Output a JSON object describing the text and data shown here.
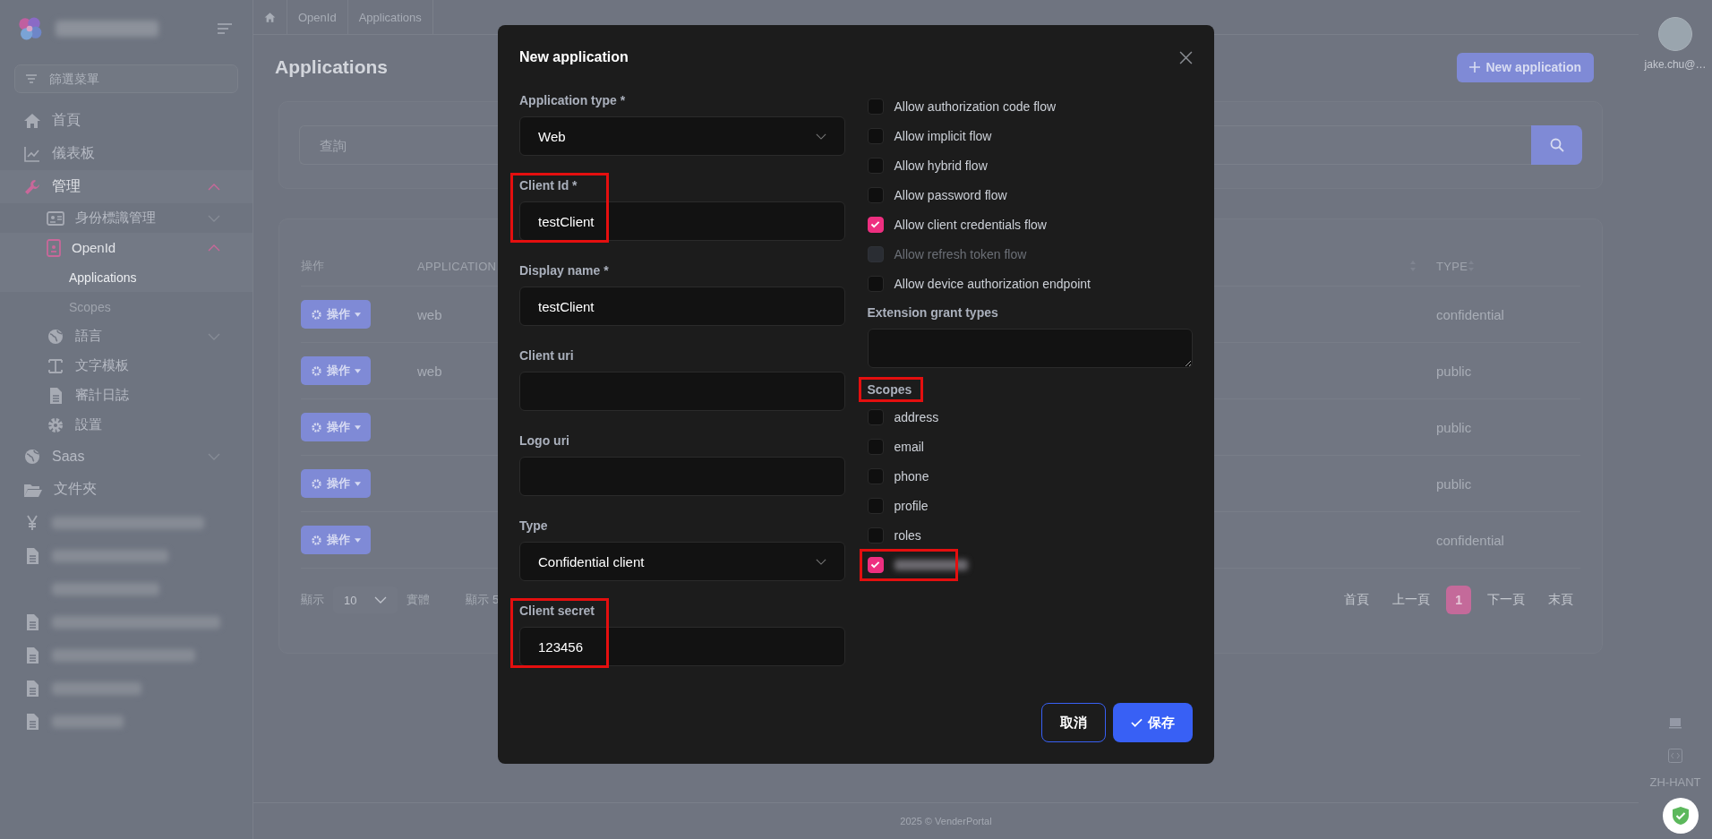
{
  "sidebar": {
    "filter": {
      "placeholder": "篩選菜單"
    },
    "items": [
      {
        "kind": "link",
        "label": "首頁"
      },
      {
        "kind": "link",
        "label": "儀表板"
      },
      {
        "kind": "group",
        "label": "管理",
        "expanded": true,
        "children": [
          {
            "kind": "group",
            "label": "身份標識管理",
            "expanded": false
          },
          {
            "kind": "group",
            "label": "OpenId",
            "expanded": true,
            "children": [
              {
                "kind": "link",
                "label": "Applications",
                "selected": true
              },
              {
                "kind": "link",
                "label": "Scopes",
                "selected": false
              }
            ]
          },
          {
            "kind": "group",
            "label": "語言",
            "expanded": false
          },
          {
            "kind": "link",
            "label": "文字模板"
          },
          {
            "kind": "link",
            "label": "審計日誌"
          },
          {
            "kind": "link",
            "label": "設置"
          }
        ]
      },
      {
        "kind": "group",
        "label": "Saas",
        "expanded": false
      },
      {
        "kind": "link",
        "label": "文件夾"
      },
      {
        "kind": "redacted"
      },
      {
        "kind": "redacted"
      },
      {
        "kind": "redacted"
      },
      {
        "kind": "redacted"
      },
      {
        "kind": "redacted"
      },
      {
        "kind": "redacted"
      },
      {
        "kind": "redacted"
      }
    ]
  },
  "breadcrumb": [
    "OpenId",
    "Applications"
  ],
  "page": {
    "title": "Applications",
    "new_button": "New application",
    "search": {
      "placeholder": "查詢"
    },
    "table": {
      "columns": [
        "操作",
        "APPLICATION",
        "TYPE"
      ],
      "rows": [
        {
          "action": "操作",
          "application": "web",
          "type": "confidential"
        },
        {
          "action": "操作",
          "application": "web",
          "type": "public"
        },
        {
          "action": "操作",
          "type": "public"
        },
        {
          "action": "操作",
          "type": "public"
        },
        {
          "action": "操作",
          "type": "confidential"
        }
      ]
    },
    "pagination": {
      "show_label": "顯示",
      "page_size": "10",
      "entities_label": "實體",
      "summary": "顯示 5",
      "pages": [
        {
          "label": "首頁",
          "selected": false
        },
        {
          "label": "上一頁",
          "selected": false
        },
        {
          "label": "1",
          "selected": true
        },
        {
          "label": "下一頁",
          "selected": false
        },
        {
          "label": "末頁",
          "selected": false
        }
      ]
    }
  },
  "rail": {
    "user": "jake.chu@…",
    "language": "ZH-HANT"
  },
  "footer": "2025 © VenderPortal",
  "modal": {
    "title": "New application",
    "fields": [
      {
        "kind": "select",
        "label": "Application type *",
        "value": "Web"
      },
      {
        "kind": "text",
        "label": "Client Id *",
        "value": "testClient",
        "highlighted": true
      },
      {
        "kind": "text",
        "label": "Display name *",
        "value": "testClient"
      },
      {
        "kind": "text",
        "label": "Client uri"
      },
      {
        "kind": "text",
        "label": "Logo uri"
      },
      {
        "kind": "select",
        "label": "Type",
        "value": "Confidential client"
      },
      {
        "kind": "text",
        "label": "Client secret",
        "value": "123456",
        "highlighted": true
      }
    ],
    "flows": [
      {
        "label": "Allow authorization code flow",
        "checked": false,
        "disabled": false
      },
      {
        "label": "Allow implicit flow",
        "checked": false,
        "disabled": false
      },
      {
        "label": "Allow hybrid flow",
        "checked": false,
        "disabled": false
      },
      {
        "label": "Allow password flow",
        "checked": false,
        "disabled": false
      },
      {
        "label": "Allow client credentials flow",
        "checked": true,
        "disabled": false
      },
      {
        "label": "Allow refresh token flow",
        "checked": false,
        "disabled": true
      },
      {
        "label": "Allow device authorization endpoint",
        "checked": false,
        "disabled": false
      }
    ],
    "extension_grant_types": {
      "label": "Extension grant types"
    },
    "scopes": {
      "label": "Scopes",
      "highlighted": true,
      "items": [
        {
          "kind": "plain",
          "label": "address",
          "checked": false
        },
        {
          "kind": "plain",
          "label": "email",
          "checked": false
        },
        {
          "kind": "plain",
          "label": "phone",
          "checked": false
        },
        {
          "kind": "plain",
          "label": "profile",
          "checked": false
        },
        {
          "kind": "plain",
          "label": "roles",
          "checked": false
        },
        {
          "kind": "redacted",
          "checked": true,
          "highlighted": true
        }
      ]
    },
    "buttons": [
      {
        "kind": "outline",
        "label": "取消"
      },
      {
        "kind": "primary",
        "label": "保存"
      }
    ]
  }
}
